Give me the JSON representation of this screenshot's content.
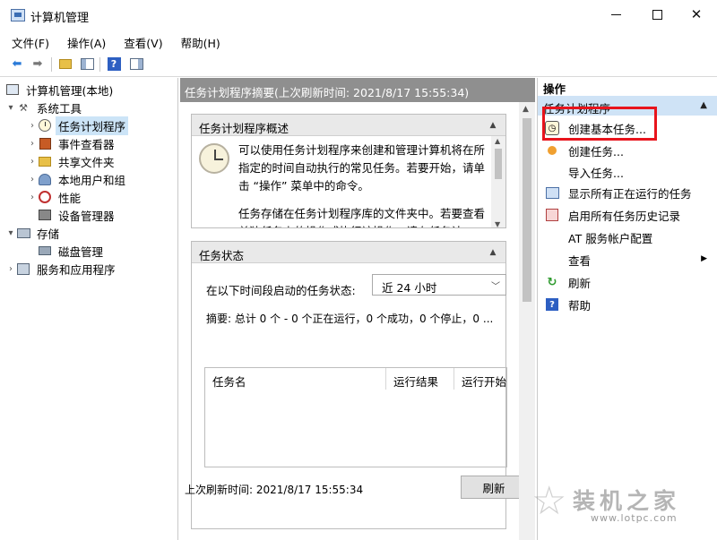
{
  "window": {
    "title": "计算机管理"
  },
  "menu": [
    "文件(F)",
    "操作(A)",
    "查看(V)",
    "帮助(H)"
  ],
  "toolbar": {
    "icons": [
      "back-arrow-icon",
      "forward-arrow-icon",
      "up-folder-icon",
      "show-hide-tree-icon",
      "help-icon",
      "show-hide-action-pane-icon"
    ]
  },
  "tree": {
    "root": "计算机管理(本地)",
    "system_tools": "系统工具",
    "task_scheduler": "任务计划程序",
    "event_viewer": "事件查看器",
    "shared_folders": "共享文件夹",
    "local_users": "本地用户和组",
    "performance": "性能",
    "device_manager": "设备管理器",
    "storage": "存储",
    "disk_management": "磁盘管理",
    "services": "服务和应用程序"
  },
  "middle": {
    "header": "任务计划程序摘要(上次刷新时间: 2021/8/17 15:55:34)",
    "overview": {
      "title": "任务计划程序概述",
      "para1": "可以使用任务计划程序来创建和管理计算机将在所指定的时间自动执行的常见任务。若要开始，请单击 “操作” 菜单中的命令。",
      "para2": "任务存储在任务计划程序库的文件夹中。若要查看单独任务上的操作或执行该操作，请在任务计"
    },
    "status": {
      "title": "任务状态",
      "filter_label": "在以下时间段启动的任务状态:",
      "filter_value": "近 24 小时",
      "summary": "摘要: 总计 0 个 - 0 个正在运行，0 个成功，0 个停止，0 ...",
      "columns": [
        "任务名",
        "运行结果",
        "运行开始"
      ],
      "last_refresh": "上次刷新时间: 2021/8/17 15:55:34",
      "refresh_button": "刷新"
    }
  },
  "actions": {
    "title": "操作",
    "group": "任务计划程序",
    "items": [
      "创建基本任务...",
      "创建任务...",
      "导入任务...",
      "显示所有正在运行的任务",
      "启用所有任务历史记录",
      "AT 服务帐户配置",
      "查看",
      "刷新",
      "帮助"
    ],
    "highlight_color": "#e8141c"
  },
  "watermark": {
    "text": "装机之家",
    "url": "www.lotpc.com"
  }
}
